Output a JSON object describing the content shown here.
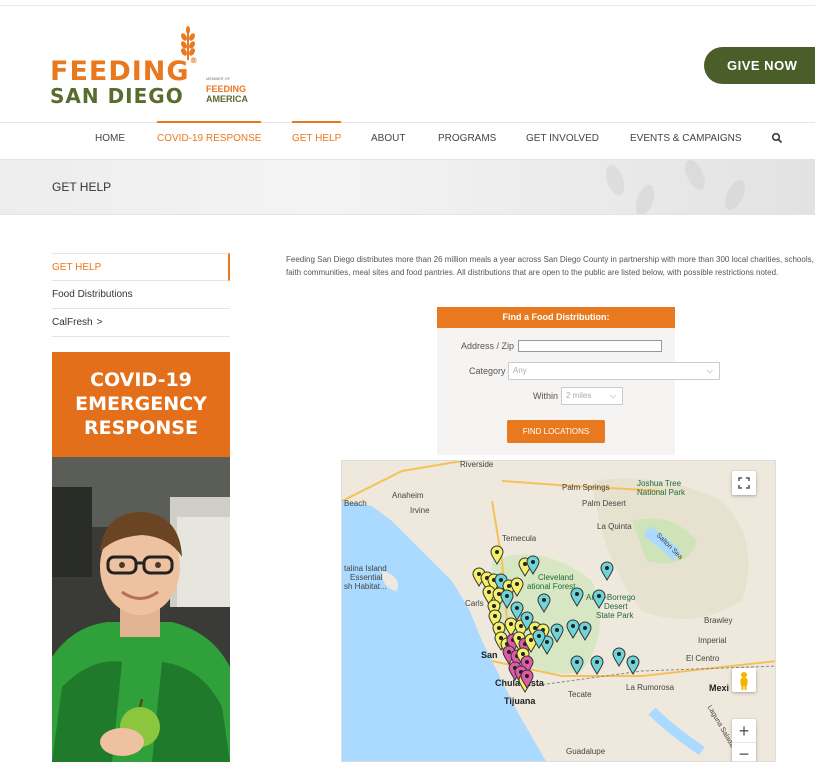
{
  "logo": {
    "line1": "FEEDING",
    "reg": "®",
    "line2": "SAN DIEGO",
    "member_of": "MEMBER OF",
    "partner1": "FEEDING",
    "partner2": "AMERICA"
  },
  "header": {
    "give_label": "GIVE NOW"
  },
  "nav": {
    "items": [
      {
        "label": "HOME"
      },
      {
        "label": "COVID-19 RESPONSE"
      },
      {
        "label": "GET HELP"
      },
      {
        "label": "ABOUT"
      },
      {
        "label": "PROGRAMS"
      },
      {
        "label": "GET INVOLVED"
      },
      {
        "label": "EVENTS & CAMPAIGNS"
      }
    ],
    "active_color": "#e8791e"
  },
  "page": {
    "title": "GET HELP"
  },
  "sidebar": {
    "links": [
      {
        "label": "GET HELP"
      },
      {
        "label": "Food Distributions"
      },
      {
        "label": "CalFresh",
        "suffix": ">"
      }
    ],
    "promo": {
      "line1": "COVID-19",
      "line2": "EMERGENCY",
      "line3": "RESPONSE"
    }
  },
  "intro": "Feeding San Diego distributes more than 26 million meals a year across San Diego County in partnership with more than 300 local charities, schools, faith communities, meal sites and food pantries. All distributions that are open to the public are listed below, with possible restrictions noted.",
  "finder": {
    "title": "Find a Food Distribution:",
    "address_label": "Address / Zip",
    "address_value": "",
    "category_label": "Category",
    "category_value": "Any",
    "within_label": "Within",
    "within_value": "2 miles",
    "button": "FIND LOCATIONS"
  },
  "map": {
    "labels": {
      "riverside": "Riverside",
      "anaheim": "Anaheim",
      "irvine": "Irvine",
      "beach": "Beach",
      "palm_springs": "Palm Springs",
      "palm_desert": "Palm Desert",
      "joshua1": "Joshua Tree",
      "joshua2": "National Park",
      "la_quinta": "La Quinta",
      "temecula": "Temecula",
      "catalina1": "talina Island",
      "catalina2": "Essential",
      "catalina3": "sh Habitat...",
      "cleveland1": "Cleveland",
      "cleveland2": "ational Forest",
      "anza1": "Anza-Borrego",
      "anza2": "Desert",
      "anza3": "State Park",
      "salton": "Salton Sea",
      "carlsbad": "Carls",
      "brawley": "Brawley",
      "imperial": "Imperial",
      "el_centro": "El Centro",
      "san_diego": "San",
      "chula_vista": "Chula Vista",
      "tecate": "Tecate",
      "la_rumorosa": "La Rumorosa",
      "tijuana": "Tijuana",
      "mexicali": "Mexi",
      "guadalupe": "Guadalupe",
      "laguna": "Laguna Salada"
    },
    "marker_colors": {
      "yellow": "#f5f06a",
      "teal": "#6fd4d8",
      "pink": "#e05aa8"
    },
    "zoom_in": "+",
    "zoom_out": "−"
  }
}
